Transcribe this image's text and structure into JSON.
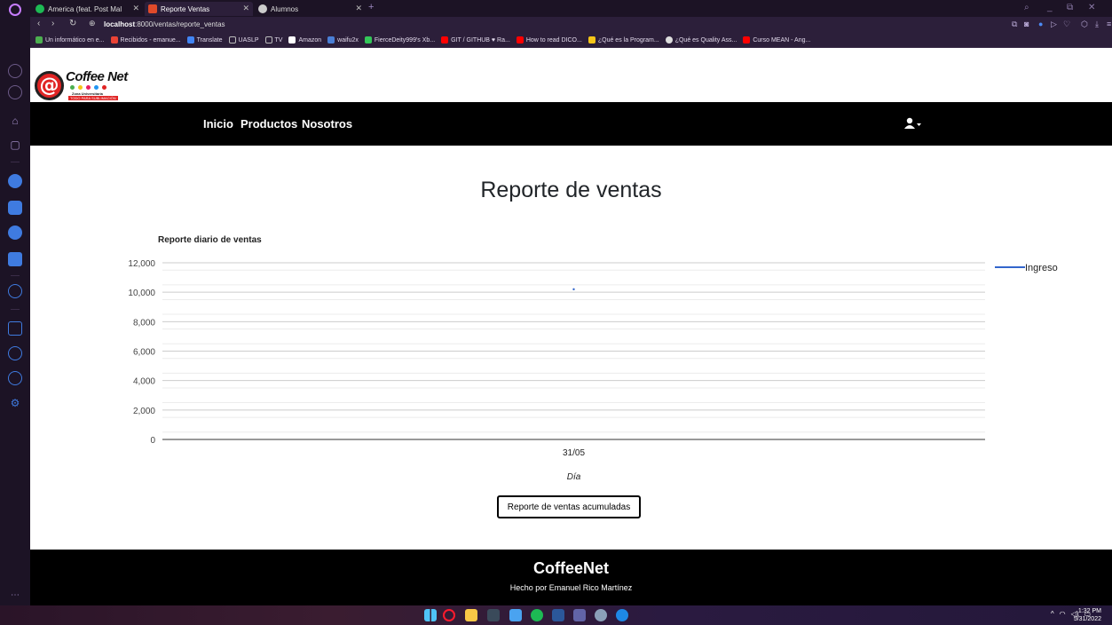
{
  "browser": {
    "tabs": [
      {
        "title": "America (feat. Post Mal",
        "favicon_color": "#1db954"
      },
      {
        "title": "Reporte Ventas",
        "favicon_color": "#e04a2a"
      },
      {
        "title": "Alumnos",
        "favicon_color": "#ddd"
      }
    ],
    "new_tab": "+",
    "url_host": "localhost",
    "url_rest": ":8000/ventas/reporte_ventas",
    "bookmarks": [
      {
        "label": "Un informático en e...",
        "color": "#4caf50"
      },
      {
        "label": "Recibidos - emanue...",
        "color": "#ea4335"
      },
      {
        "label": "Translate",
        "color": "#4285f4"
      },
      {
        "label": "UASLP",
        "color": "#bbb"
      },
      {
        "label": "TV",
        "color": "#bbb"
      },
      {
        "label": "Amazon",
        "color": "#fff"
      },
      {
        "label": "waifu2x",
        "color": "#4a7fd6"
      },
      {
        "label": "FierceDeity999's Xb...",
        "color": "#34c759"
      },
      {
        "label": "GIT / GITHUB ♥ Ra...",
        "color": "#ff0000"
      },
      {
        "label": "How to read DICO...",
        "color": "#ff0000"
      },
      {
        "label": "¿Qué es la Program...",
        "color": "#f5c518"
      },
      {
        "label": "¿Qué es Quality Ass...",
        "color": "#ddd"
      },
      {
        "label": "Curso MEAN - Ang...",
        "color": "#ff0000"
      }
    ]
  },
  "site": {
    "logo": {
      "name": "Coffee Net",
      "zone": "Zona Universitaria",
      "tagline": "TODO PARA SUBLIMACIÓN"
    },
    "nav": {
      "home": "Inicio",
      "products": "Productos",
      "about": "Nosotros"
    },
    "page_title": "Reporte de ventas",
    "accumulated_button": "Reporte de ventas acumuladas",
    "footer": {
      "brand": "CoffeeNet",
      "credit": "Hecho por Emanuel Rico Martínez"
    }
  },
  "chart_data": {
    "type": "line",
    "title": "Reporte diario de ventas",
    "xlabel": "Día",
    "ylabel": "",
    "categories": [
      "31/05"
    ],
    "series": [
      {
        "name": "Ingreso",
        "values": [
          10200
        ],
        "color": "#3366cc"
      }
    ],
    "ylim": [
      0,
      12000
    ],
    "yticks": [
      "0",
      "2,000",
      "4,000",
      "6,000",
      "8,000",
      "10,000",
      "12,000"
    ],
    "grid": true,
    "legend": "right"
  },
  "taskbar": {
    "clock_time": "1:32 PM",
    "clock_date": "5/31/2022"
  }
}
